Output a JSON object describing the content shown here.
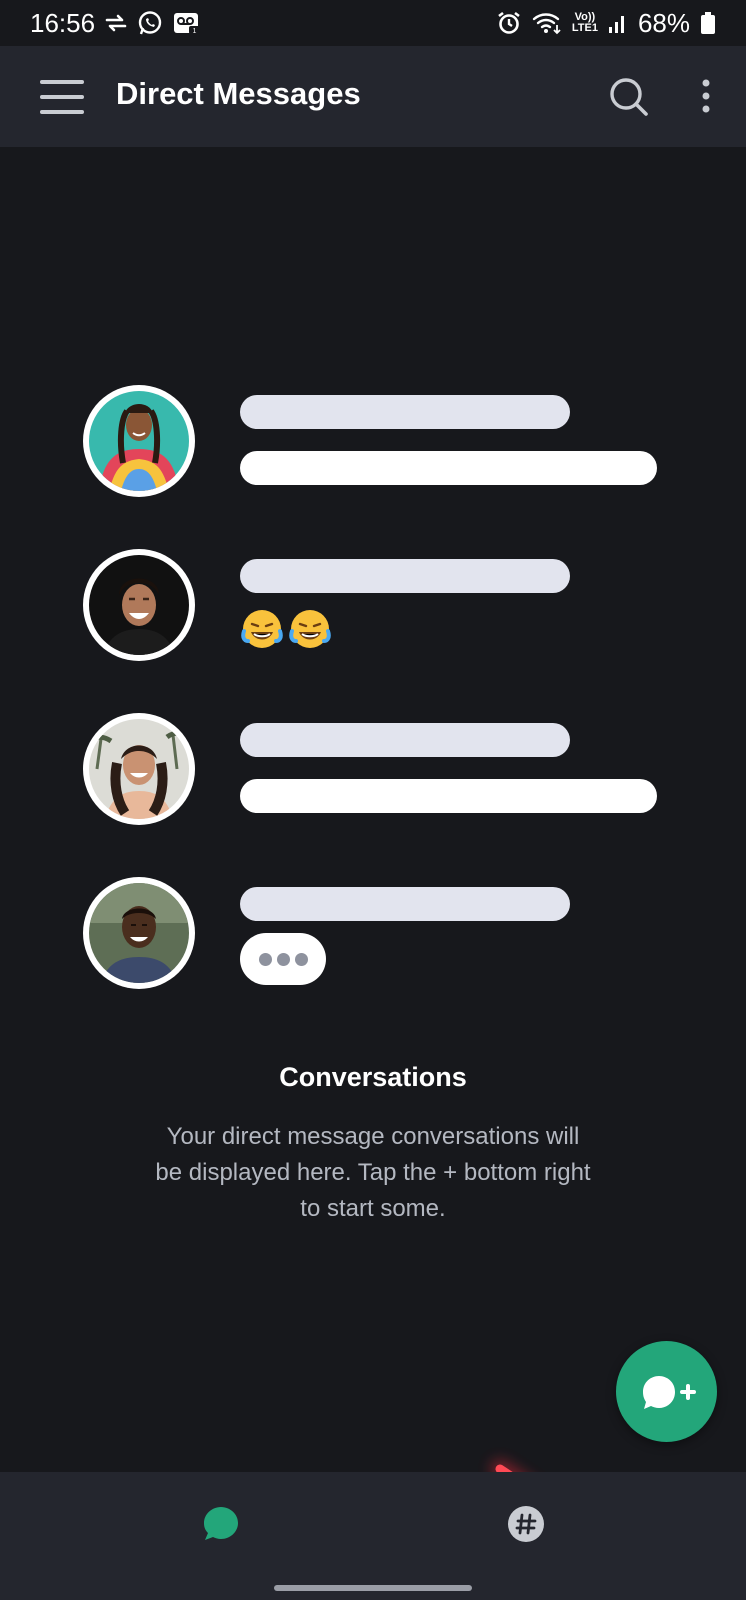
{
  "status_bar": {
    "time": "16:56",
    "battery": "68%",
    "left_icons": [
      "data-transfer-icon",
      "whatsapp-icon",
      "voicemail-icon"
    ],
    "right_icons": [
      "alarm-icon",
      "wifi-icon",
      "volte-icon",
      "signal-icon",
      "battery-icon"
    ],
    "volte_label_top": "Vo))",
    "volte_label_bottom": "LTE1"
  },
  "app_bar": {
    "title": "Direct Messages",
    "menu_icon": "hamburger-menu-icon",
    "search_icon": "search-icon",
    "more_icon": "more-vertical-icon"
  },
  "placeholder_rows": [
    {
      "avatar": "avatar-woman-braids",
      "preview": "bar"
    },
    {
      "avatar": "avatar-man-laughing",
      "preview": "😂😂"
    },
    {
      "avatar": "avatar-woman-smiling",
      "preview": "bar"
    },
    {
      "avatar": "avatar-man-smiling",
      "preview": "typing-indicator"
    }
  ],
  "empty_state": {
    "title": "Conversations",
    "description": "Your direct message conversations will be displayed here. Tap the + bottom right to start some."
  },
  "fab": {
    "icon": "new-message-icon",
    "label": "+"
  },
  "bottom_nav": {
    "items": [
      {
        "name": "direct-messages",
        "icon": "chat-bubble-icon",
        "active": true
      },
      {
        "name": "channels",
        "icon": "hashtag-icon",
        "active": false
      }
    ]
  },
  "colors": {
    "background": "#17181c",
    "app_bar": "#24262e",
    "accent": "#23a67a",
    "arrow": "#ff4a55",
    "muted_text": "#b4b8c1"
  }
}
